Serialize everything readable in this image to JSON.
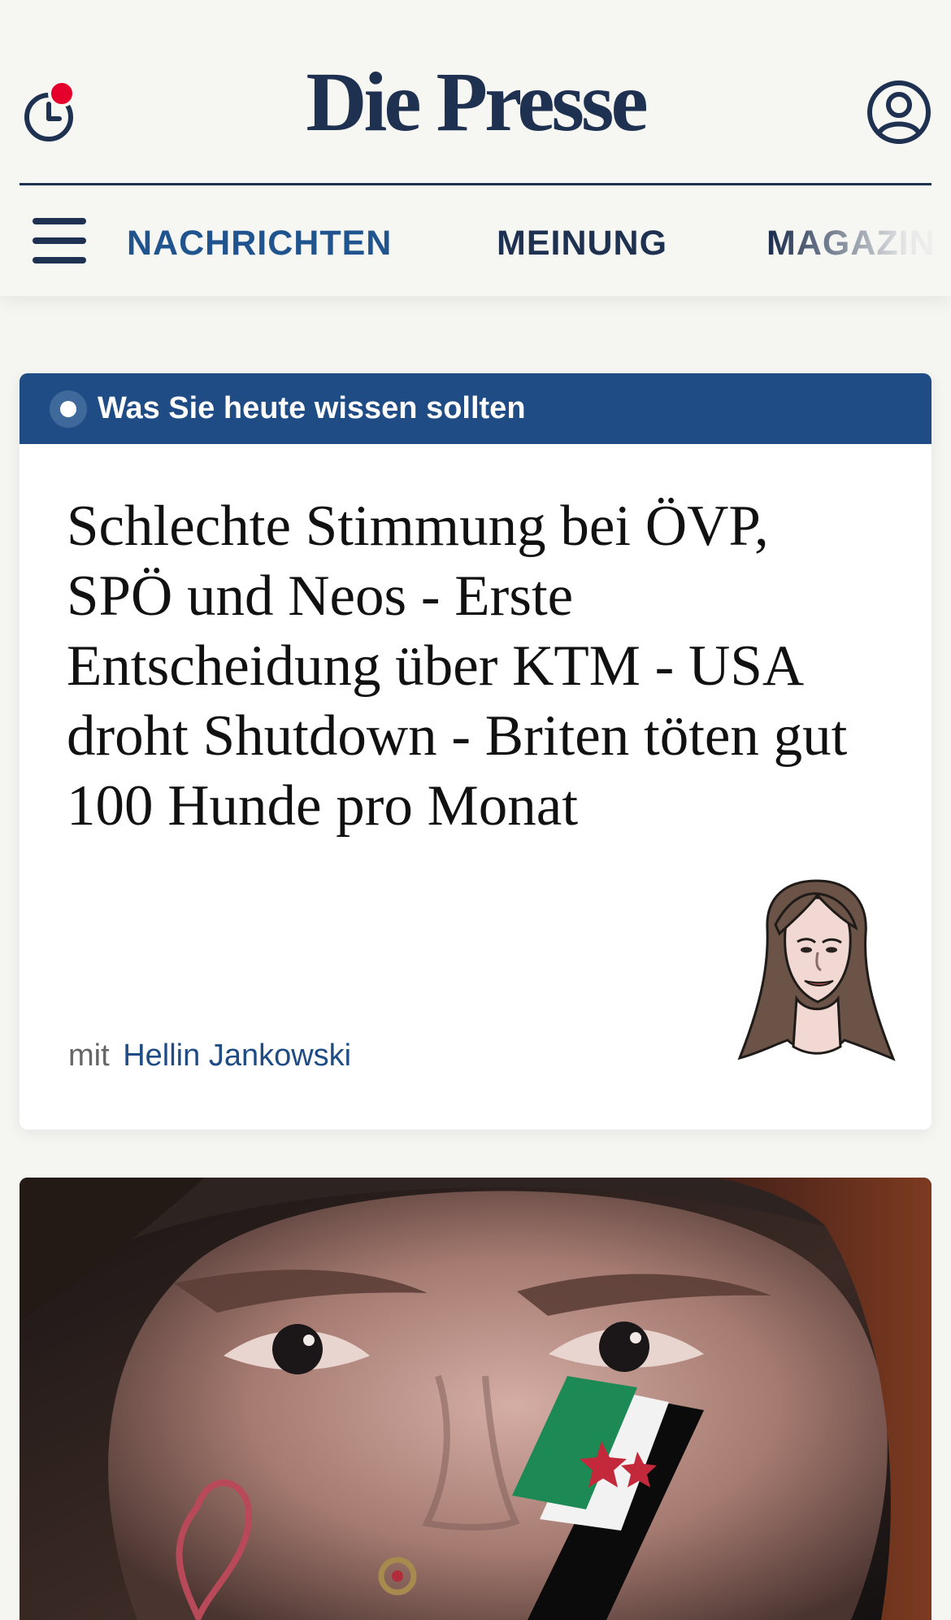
{
  "header": {
    "logo": "Die Presse",
    "icons": {
      "recent": "history-clock-icon",
      "notification": "notification-dot",
      "account": "user-account-icon"
    },
    "colors": {
      "brand": "#1f3150",
      "accent": "#e4002b"
    }
  },
  "nav": {
    "menu_icon": "hamburger-menu-icon",
    "items": [
      {
        "label": "NACHRICHTEN",
        "active": true
      },
      {
        "label": "MEINUNG",
        "active": false
      },
      {
        "label": "MAGAZIN",
        "active": false
      }
    ]
  },
  "briefing": {
    "label": "Was Sie heute wissen sollten",
    "live_icon": "live-indicator-icon",
    "headline": "Schlechte Stimmung bei ÖVP, SPÖ und Neos - Erste Entscheidung über KTM - USA droht Shutdown - Briten töten gut 100 Hunde pro Monat",
    "author_prefix": "mit",
    "author_name": "Hellin Jankowski",
    "colors": {
      "bar": "#1f4c84",
      "author_link": "#1f4c84"
    }
  },
  "article_image": {
    "icon": "face-photo"
  }
}
